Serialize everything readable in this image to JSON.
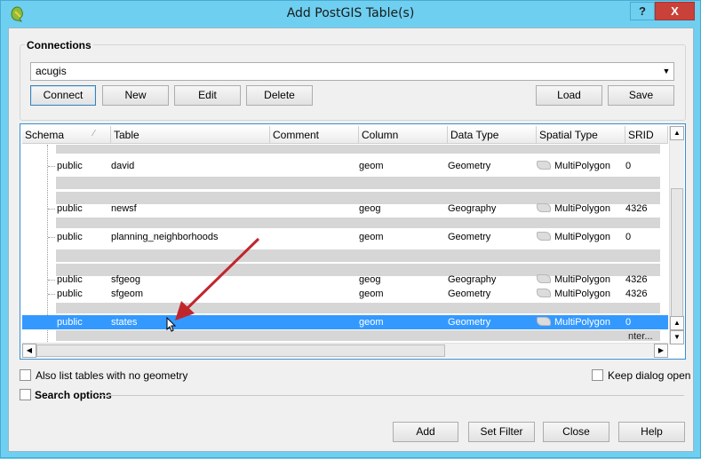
{
  "window": {
    "title": "Add PostGIS Table(s)",
    "help_glyph": "?",
    "close_glyph": "X"
  },
  "connections": {
    "group_title": "Connections",
    "selected": "acugis",
    "buttons": {
      "connect": "Connect",
      "new": "New",
      "edit": "Edit",
      "delete": "Delete",
      "load": "Load",
      "save": "Save"
    }
  },
  "table": {
    "columns": [
      "Schema",
      "Table",
      "Comment",
      "Column",
      "Data Type",
      "Spatial Type",
      "SRID"
    ],
    "rows": [
      {
        "schema": "public",
        "table": "david",
        "column": "geom",
        "data_type": "Geometry",
        "spatial_type": "MultiPolygon",
        "srid": "0"
      },
      {
        "schema": "public",
        "table": "newsf",
        "column": "geog",
        "data_type": "Geography",
        "spatial_type": "MultiPolygon",
        "srid": "4326"
      },
      {
        "schema": "public",
        "table": "planning_neighborhoods",
        "column": "geom",
        "data_type": "Geometry",
        "spatial_type": "MultiPolygon",
        "srid": "0"
      },
      {
        "schema": "public",
        "table": "sfgeog",
        "column": "geog",
        "data_type": "Geography",
        "spatial_type": "MultiPolygon",
        "srid": "4326"
      },
      {
        "schema": "public",
        "table": "sfgeom",
        "column": "geom",
        "data_type": "Geometry",
        "spatial_type": "MultiPolygon",
        "srid": "4326"
      },
      {
        "schema": "public",
        "table": "states",
        "column": "geom",
        "data_type": "Geometry",
        "spatial_type": "MultiPolygon",
        "srid": "0"
      }
    ],
    "partial_row_text": "nter..."
  },
  "options": {
    "list_no_geometry": "Also list tables with no geometry",
    "keep_open": "Keep dialog open",
    "search_options": "Search options"
  },
  "footer": {
    "add": "Add",
    "set_filter": "Set Filter",
    "close": "Close",
    "help": "Help"
  },
  "colors": {
    "selection": "#3399ff",
    "title_bar": "#6ecff0",
    "close_button": "#c8423a",
    "arrow": "#c0272d"
  }
}
